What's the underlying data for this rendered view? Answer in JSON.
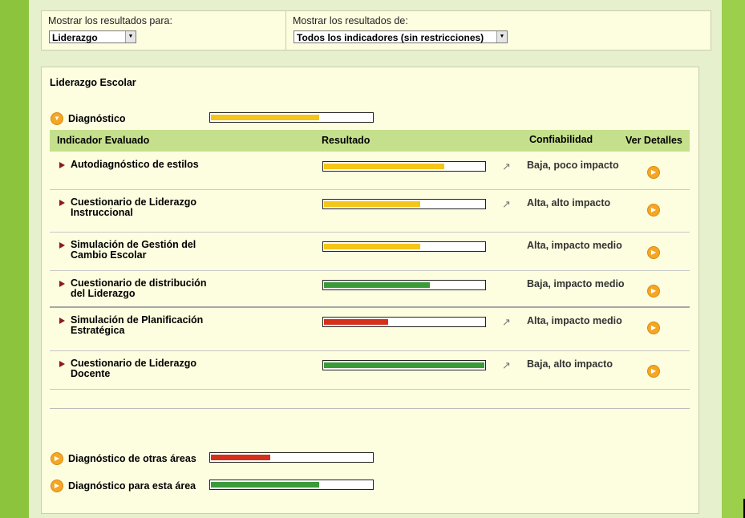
{
  "filters": {
    "for_label": "Mostrar los resultados para:",
    "for_value": "Liderazgo",
    "of_label": "Mostrar los resultados de:",
    "of_value": "Todos los indicadores (sin restricciones)"
  },
  "section": {
    "title": "Liderazgo Escolar",
    "diagnostic_label": "Diagnóstico",
    "diagnostic_level": 0.67,
    "diagnostic_color": "#f5c518"
  },
  "table": {
    "headers": {
      "indicator": "Indicador Evaluado",
      "result": "Resultado",
      "reliability": "Confiabilidad",
      "details": "Ver Detalles"
    },
    "rows": [
      {
        "name": "Autodiagnóstico de estilos",
        "level": 0.75,
        "color": "#f5c518",
        "trend": "↗",
        "reliability": "Baja, poco impacto"
      },
      {
        "name": "Cuestionario de Liderazgo Instruccional",
        "level": 0.6,
        "color": "#f5c518",
        "trend": "↗",
        "reliability": "Alta, alto impacto"
      },
      {
        "name": "Simulación de Gestión del Cambio Escolar",
        "level": 0.6,
        "color": "#f5c518",
        "trend": "",
        "reliability": "Alta, impacto medio"
      },
      {
        "name": "Cuestionario de distribución del Liderazgo",
        "level": 0.66,
        "color": "#3a9a3a",
        "trend": "",
        "reliability": "Baja, impacto medio"
      },
      {
        "name": "Simulación de Planificación Estratégica",
        "level": 0.4,
        "color": "#d4301a",
        "trend": "↗",
        "reliability": "Alta, impacto medio"
      },
      {
        "name": "Cuestionario de Liderazgo Docente",
        "level": 1.0,
        "color": "#3a9a3a",
        "trend": "↗",
        "reliability": "Baja, alto impacto"
      }
    ]
  },
  "summary": [
    {
      "label": "Diagnóstico de otras áreas",
      "level": 0.37,
      "color": "#d4301a"
    },
    {
      "label": "Diagnóstico para esta área",
      "level": 0.67,
      "color": "#3a9a3a"
    }
  ]
}
